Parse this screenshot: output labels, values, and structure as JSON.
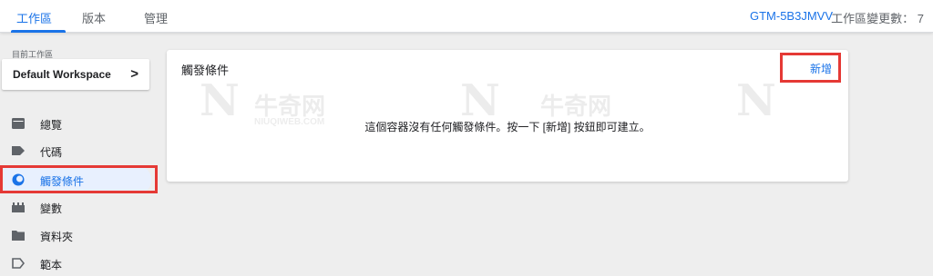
{
  "tabs": [
    {
      "label": "工作區"
    },
    {
      "label": "版本"
    },
    {
      "label": "管理"
    }
  ],
  "container_id": "GTM-5B3JMVV",
  "workspace_changes": "工作區變更數： 7",
  "sidebar": {
    "current_workspace_label": "目前工作區",
    "workspace_name": "Default Workspace",
    "chevron": ">",
    "items": [
      {
        "label": "總覽",
        "icon": "overview-icon"
      },
      {
        "label": "代碼",
        "icon": "tag-icon"
      },
      {
        "label": "觸發條件",
        "icon": "trigger-icon"
      },
      {
        "label": "變數",
        "icon": "variables-icon"
      },
      {
        "label": "資料夾",
        "icon": "folder-icon"
      },
      {
        "label": "範本",
        "icon": "template-icon"
      }
    ]
  },
  "main": {
    "title": "觸發條件",
    "new_button": "新增",
    "empty_message": "這個容器沒有任何觸發條件。按一下 [新增] 按鈕即可建立。"
  },
  "watermark": {
    "text": "牛奇网",
    "subtext": "NIUQIWEB.COM"
  },
  "colors": {
    "accent": "#1a73e8",
    "highlight": "#e53935",
    "background": "#eeeeee"
  }
}
